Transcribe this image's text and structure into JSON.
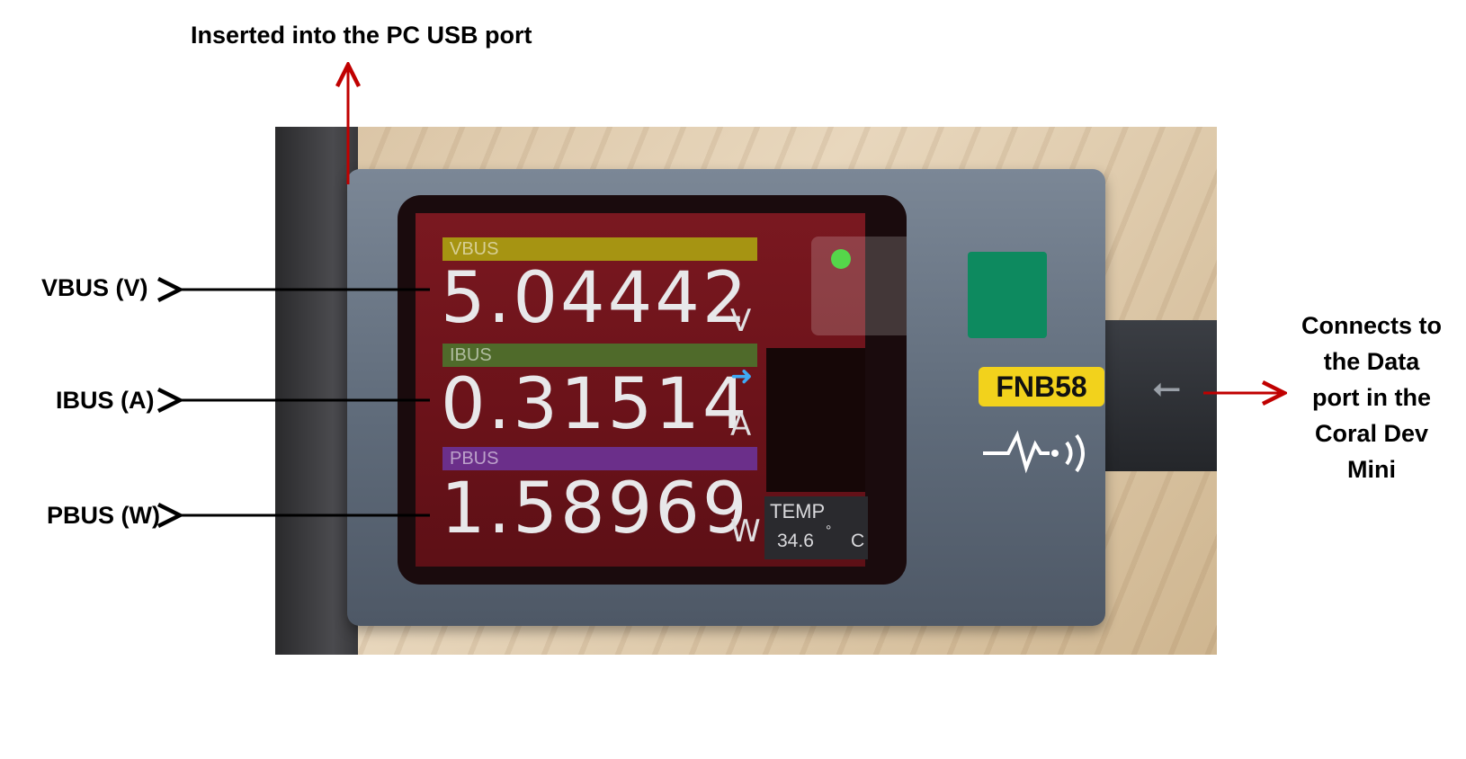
{
  "annotations": {
    "top": "Inserted into the PC USB port",
    "vbus": "VBUS (V)",
    "ibus": "IBUS (A)",
    "pbus": "PBUS (W)",
    "right_lines": [
      "Connects to",
      "the Data",
      "port in the",
      "Coral Dev",
      "Mini"
    ]
  },
  "device": {
    "brand": "FNB58",
    "vbus_label": "VBUS",
    "ibus_label": "IBUS",
    "pbus_label": "PBUS",
    "vbus_value": "5.04442",
    "ibus_value": "0.31514",
    "pbus_value": "1.58969",
    "vbus_unit": "V",
    "ibus_unit": "A",
    "pbus_unit": "W",
    "temp_label": "TEMP",
    "temp_value": "34.6",
    "temp_degree": "°",
    "temp_unit": "C",
    "direction_icon": "right-arrow-icon",
    "pulse_icon": "signal-pulse-icon",
    "usb_icon": "usb-icon"
  },
  "colors": {
    "arrow_red": "#c00000",
    "arrow_black": "#000000",
    "badge_yellow": "#f2d21c",
    "screen_red": "#7a1820",
    "vbus_bar": "#a69412",
    "ibus_bar": "#4f6a2a",
    "pbus_bar": "#6b2f8a"
  }
}
